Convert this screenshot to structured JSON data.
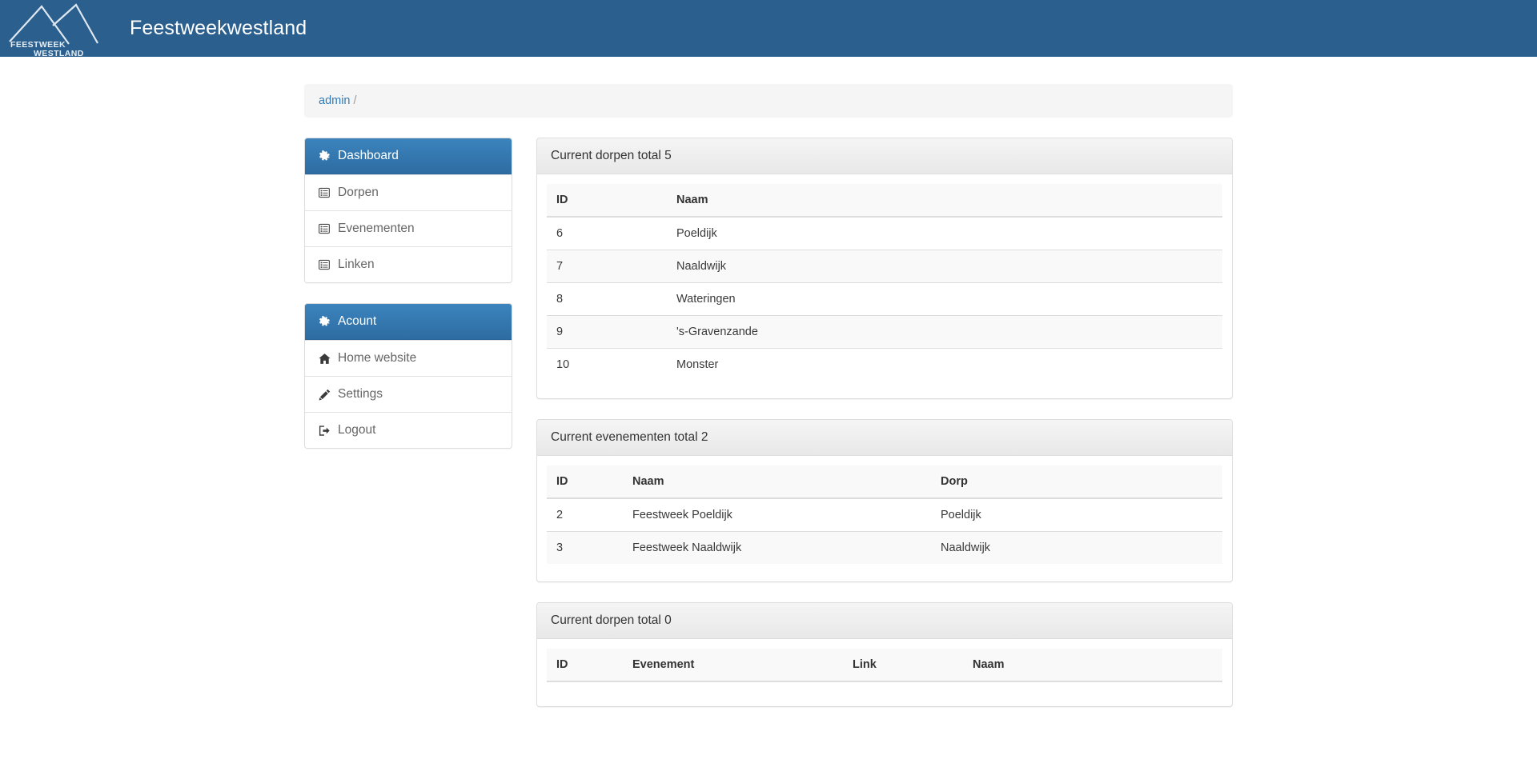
{
  "navbar": {
    "brand": "Feestweekwestland",
    "logo_icon": "feestweek-westland-mountain-logo",
    "logo_text_top": "FEESTWEEK",
    "logo_text_bottom": "WESTLAND",
    "background_color": "#2b5f8e"
  },
  "breadcrumb": {
    "root_label": "admin",
    "separator": "/"
  },
  "sidebar": {
    "groups": [
      {
        "header": {
          "label": "Dashboard",
          "icon": "gear-icon"
        },
        "items": [
          {
            "label": "Dorpen",
            "icon": "list-alt-icon"
          },
          {
            "label": "Evenementen",
            "icon": "list-alt-icon"
          },
          {
            "label": "Linken",
            "icon": "list-alt-icon"
          }
        ]
      },
      {
        "header": {
          "label": "Acount",
          "icon": "gear-icon"
        },
        "items": [
          {
            "label": "Home website",
            "icon": "home-icon"
          },
          {
            "label": "Settings",
            "icon": "pencil-icon"
          },
          {
            "label": "Logout",
            "icon": "sign-out-icon"
          }
        ]
      }
    ]
  },
  "panels": {
    "dorpen": {
      "title": "Current dorpen total 5",
      "total": 5,
      "columns": [
        "ID",
        "Naam"
      ],
      "rows": [
        {
          "id": "6",
          "naam": "Poeldijk"
        },
        {
          "id": "7",
          "naam": "Naaldwijk"
        },
        {
          "id": "8",
          "naam": "Wateringen"
        },
        {
          "id": "9",
          "naam": "'s-Gravenzande"
        },
        {
          "id": "10",
          "naam": "Monster"
        }
      ]
    },
    "evenementen": {
      "title": "Current evenementen total 2",
      "total": 2,
      "columns": [
        "ID",
        "Naam",
        "Dorp"
      ],
      "rows": [
        {
          "id": "2",
          "naam": "Feestweek Poeldijk",
          "dorp": "Poeldijk"
        },
        {
          "id": "3",
          "naam": "Feestweek Naaldwijk",
          "dorp": "Naaldwijk"
        }
      ]
    },
    "linken": {
      "title": "Current dorpen total 0",
      "total": 0,
      "columns": [
        "ID",
        "Evenement",
        "Link",
        "Naam"
      ],
      "rows": []
    }
  },
  "colors": {
    "navbar": "#2b5f8e",
    "primary": "#2d6ca2",
    "primary_light": "#3c84bd",
    "link": "#337ab7",
    "panel_border": "#dddddd",
    "stripe": "#f9f9f9"
  }
}
